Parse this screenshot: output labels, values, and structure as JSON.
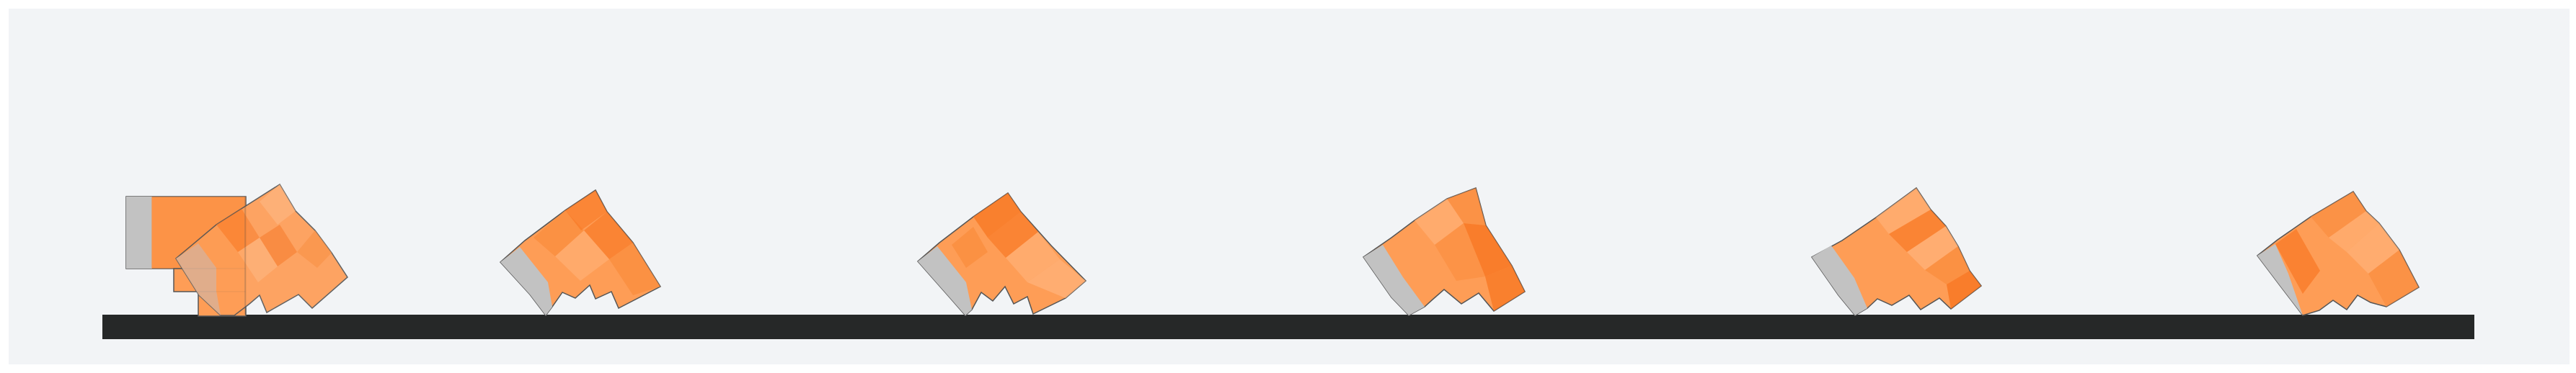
{
  "colors": {
    "page_background": "#ffffff",
    "panel_background": "#f2f4f6",
    "ground": "#262828",
    "body_orange": "#fe9d56",
    "body_orange_dark": "#f7731e",
    "body_orange_light": "#ffb47d",
    "foot_gray": "#c2c2c2",
    "outline": "#555555"
  },
  "scene": {
    "ground_label": "",
    "stages": [
      {
        "name": "stage-1",
        "variant": "initial-with-block"
      },
      {
        "name": "stage-2",
        "variant": "tilted"
      },
      {
        "name": "stage-3",
        "variant": "tilted"
      },
      {
        "name": "stage-4",
        "variant": "tilted"
      },
      {
        "name": "stage-5",
        "variant": "tilted"
      },
      {
        "name": "stage-6",
        "variant": "tilted"
      }
    ]
  }
}
